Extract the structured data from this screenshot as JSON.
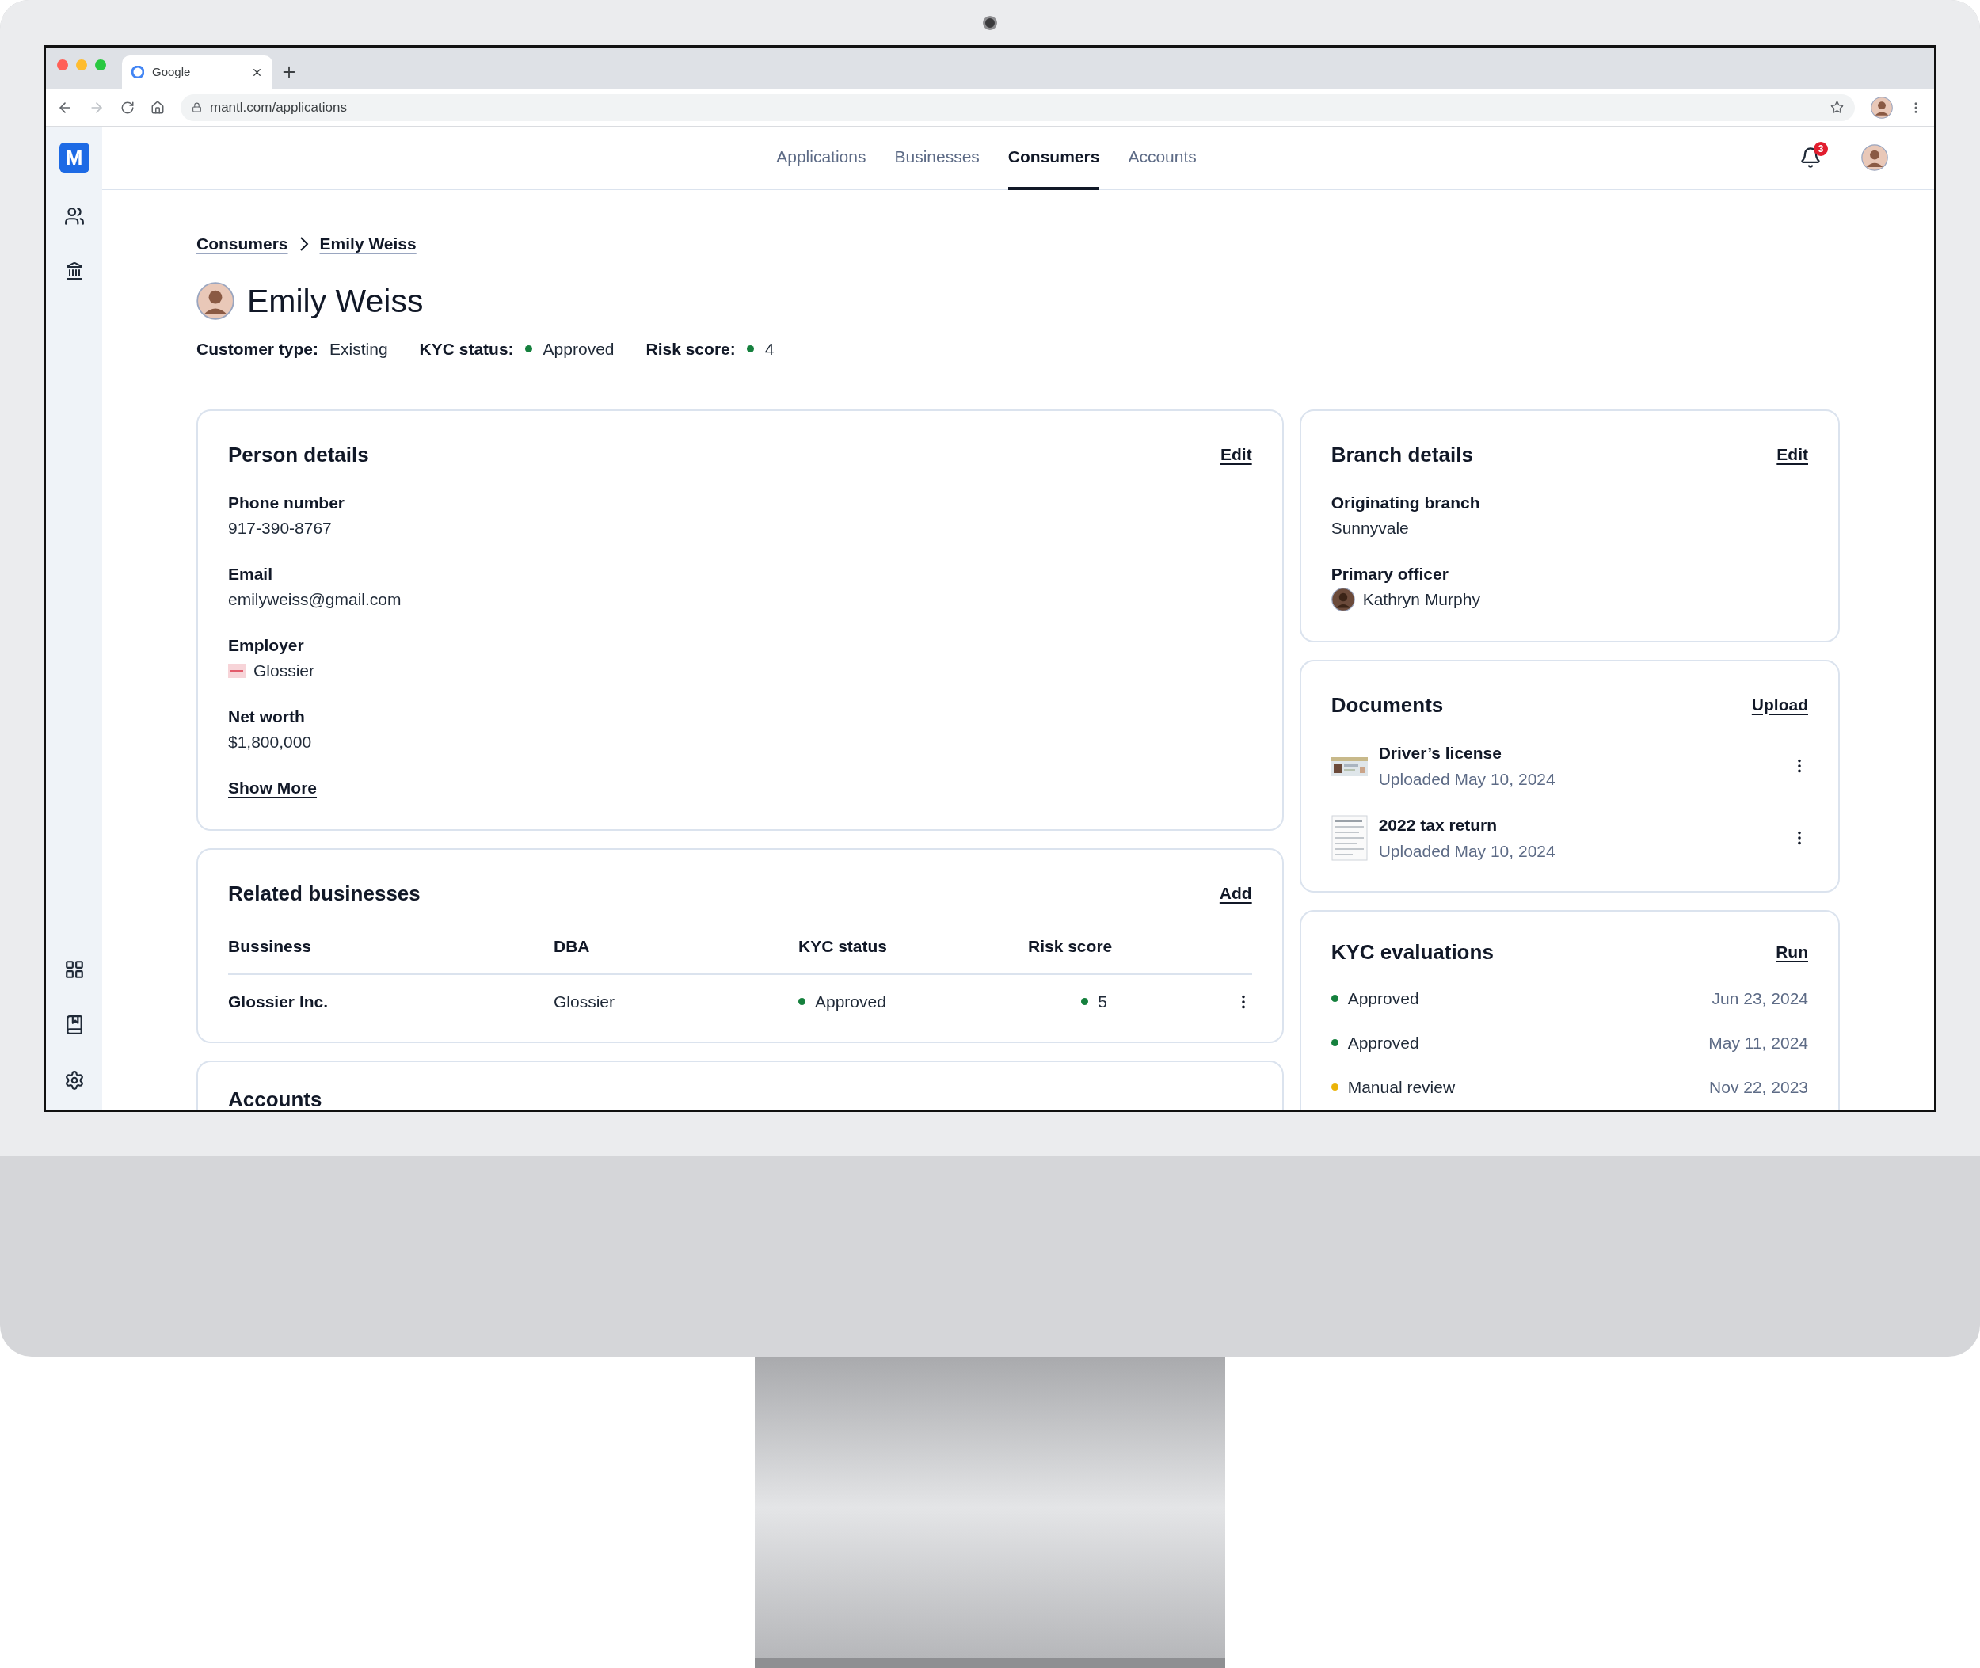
{
  "browser": {
    "tab_title": "Google",
    "url": "mantl.com/applications"
  },
  "app": {
    "logo": "M",
    "nav": [
      {
        "label": "Applications",
        "selected": false
      },
      {
        "label": "Businesses",
        "selected": false
      },
      {
        "label": "Consumers",
        "selected": true
      },
      {
        "label": "Accounts",
        "selected": false
      }
    ],
    "notification_count": "3"
  },
  "breadcrumb": [
    "Consumers",
    "Emily Weiss"
  ],
  "person": {
    "name": "Emily Weiss",
    "meta": [
      {
        "label": "Customer type:",
        "value": "Existing"
      },
      {
        "label": "KYC status:",
        "value": "Approved",
        "color": "#15803d"
      },
      {
        "label": "Risk score:",
        "value": "4",
        "color": "#15803d"
      }
    ]
  },
  "person_details": {
    "title": "Person details",
    "action": "Edit",
    "fields": [
      {
        "kind": "text",
        "label": "Phone number",
        "value": "917-390-8767"
      },
      {
        "kind": "text",
        "label": "Email",
        "value": "emilyweiss@gmail.com"
      },
      {
        "kind": "logo",
        "label": "Employer",
        "value": "Glossier"
      },
      {
        "kind": "text",
        "label": "Net worth",
        "value": "$1,800,000"
      }
    ],
    "link": "Show More"
  },
  "related_businesses": {
    "title": "Related businesses",
    "action": "Add",
    "columns": [
      "Bussiness",
      "DBA",
      "KYC status",
      "Risk score"
    ],
    "rows": [
      {
        "business": "Glossier Inc.",
        "dba": "Glossier",
        "kyc_status": {
          "text": "Approved",
          "color": "#15803d"
        },
        "risk_score": {
          "text": "5",
          "color": "#15803d"
        }
      }
    ]
  },
  "accounts": {
    "title": "Accounts"
  },
  "branch_details": {
    "title": "Branch details",
    "action": "Edit",
    "fields": [
      {
        "kind": "text",
        "label": "Originating branch",
        "value": "Sunnyvale"
      },
      {
        "kind": "avatar",
        "label": "Primary officer",
        "value": "Kathryn Murphy"
      }
    ]
  },
  "documents": {
    "title": "Documents",
    "action": "Upload",
    "items": [
      {
        "kind": "picture",
        "name": "Driver’s license",
        "uploaded": "Uploaded May 10, 2024"
      },
      {
        "kind": "picture",
        "name": "2022 tax return",
        "uploaded": "Uploaded May 10, 2024"
      }
    ]
  },
  "kyc_evaluations": {
    "title": "KYC evaluations",
    "action": "Run",
    "items": [
      {
        "status": "Approved",
        "date": "Jun 23, 2024",
        "color": "#15803d"
      },
      {
        "status": "Approved",
        "date": "May 11, 2024",
        "color": "#15803d"
      },
      {
        "status": "Manual review",
        "date": "Nov 22, 2023",
        "color": "#eab308"
      }
    ]
  }
}
